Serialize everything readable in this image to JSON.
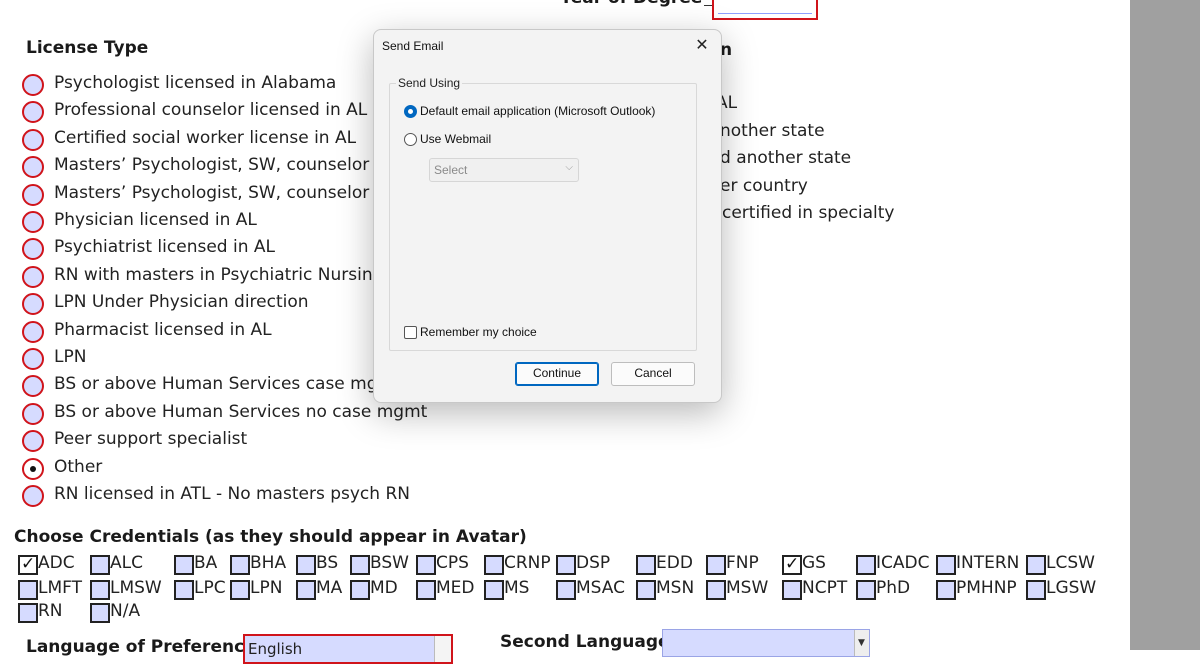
{
  "top": {
    "year_label": "Year of Degree"
  },
  "license": {
    "title": "License Type",
    "options": [
      {
        "label": "Psychologist licensed in Alabama",
        "selected": false
      },
      {
        "label": "Professional counselor licensed in AL",
        "selected": false
      },
      {
        "label": "Certified social worker license in AL",
        "selected": false
      },
      {
        "label": "Masters’ Psychologist, SW, counselor",
        "selected": false
      },
      {
        "label": "Masters’ Psychologist, SW, counselor",
        "selected": false
      },
      {
        "label": "Physician licensed in AL",
        "selected": false
      },
      {
        "label": "Psychiatrist licensed in AL",
        "selected": false
      },
      {
        "label": "RN with masters in Psychiatric Nursing",
        "selected": false
      },
      {
        "label": "LPN Under Physician direction",
        "selected": false
      },
      {
        "label": "Pharmacist licensed in AL",
        "selected": false
      },
      {
        "label": "LPN",
        "selected": false
      },
      {
        "label": "BS or above Human Services case mgmt",
        "selected": false
      },
      {
        "label": "BS or above Human Services no case mgmt",
        "selected": false
      },
      {
        "label": "Peer support specialist",
        "selected": false
      },
      {
        "label": "Other",
        "selected": true
      },
      {
        "label": "RN licensed in ATL - No masters psych RN",
        "selected": false
      }
    ]
  },
  "right_column": {
    "header_fragment": "n",
    "fragments": [
      "AL",
      "nother state",
      "d another state",
      "er country",
      "certified in specialty"
    ]
  },
  "credentials": {
    "title": "Choose Credentials (as they should appear in Avatar)",
    "items": [
      {
        "label": "ADC",
        "checked": true
      },
      {
        "label": "ALC",
        "checked": false
      },
      {
        "label": "BA",
        "checked": false
      },
      {
        "label": "BHA",
        "checked": false
      },
      {
        "label": "BS",
        "checked": false
      },
      {
        "label": "BSW",
        "checked": false
      },
      {
        "label": "CPS",
        "checked": false
      },
      {
        "label": "CRNP",
        "checked": false
      },
      {
        "label": "DSP",
        "checked": false
      },
      {
        "label": "EDD",
        "checked": false
      },
      {
        "label": "FNP",
        "checked": false
      },
      {
        "label": "GS",
        "checked": true
      },
      {
        "label": "ICADC",
        "checked": false
      },
      {
        "label": "INTERN",
        "checked": false
      },
      {
        "label": "LCSW",
        "checked": false
      },
      {
        "label": "LMFT",
        "checked": false
      },
      {
        "label": "LMSW",
        "checked": false
      },
      {
        "label": "LPC",
        "checked": false
      },
      {
        "label": "LPN",
        "checked": false
      },
      {
        "label": "MA",
        "checked": false
      },
      {
        "label": "MD",
        "checked": false
      },
      {
        "label": "MED",
        "checked": false
      },
      {
        "label": "MS",
        "checked": false
      },
      {
        "label": "MSAC",
        "checked": false
      },
      {
        "label": "MSN",
        "checked": false
      },
      {
        "label": "MSW",
        "checked": false
      },
      {
        "label": "NCPT",
        "checked": false
      },
      {
        "label": "PhD",
        "checked": false
      },
      {
        "label": "PMHNP",
        "checked": false
      },
      {
        "label": "LGSW",
        "checked": false
      },
      {
        "label": "RN",
        "checked": false
      },
      {
        "label": "N/A",
        "checked": false
      }
    ]
  },
  "language": {
    "label": "Language of Preference:",
    "value": "English",
    "second_label": "Second Language:"
  },
  "dialog": {
    "title": "Send Email",
    "close_glyph": "✕",
    "group_label": "Send Using",
    "option_default": "Default email application (Microsoft Outlook)",
    "option_webmail": "Use Webmail",
    "select_placeholder": "Select",
    "remember_label": "Remember my choice",
    "continue_label": "Continue",
    "cancel_label": "Cancel"
  }
}
